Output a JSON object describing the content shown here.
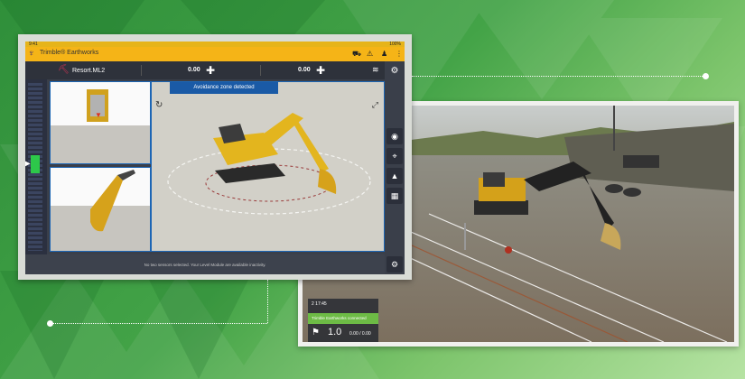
{
  "tablet": {
    "status_left": "9:41",
    "status_right": "100%",
    "app_title": "Trimble® Earthworks",
    "design_name": "Resort.ML2",
    "value_left": "0.00",
    "value_right": "0.00",
    "alert": "Avoidance zone detected",
    "bottom_message": "No two sensors selected. Your Level Module are available inactivity."
  },
  "hud": {
    "row1": "2   17:45",
    "green": "Trimble Earthworks connected",
    "big": "1.0",
    "small": "0.00 / 0.00"
  },
  "icons": {
    "logo": "trimble-logo-icon",
    "machine": "excavator-icon",
    "settings": "gear-icon"
  }
}
